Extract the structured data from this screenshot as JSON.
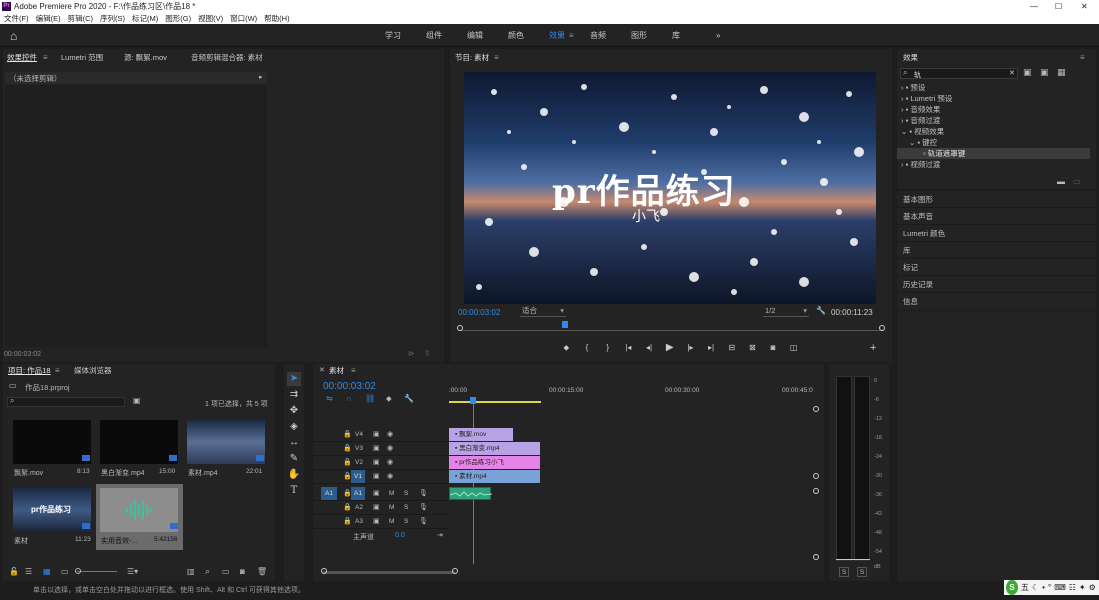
{
  "title": "Adobe Premiere Pro 2020 - F:\\作品练习区\\作品18 *",
  "menu": [
    "文件(F)",
    "编辑(E)",
    "剪辑(C)",
    "序列(S)",
    "标记(M)",
    "图形(G)",
    "视图(V)",
    "窗口(W)",
    "帮助(H)"
  ],
  "workspaces": [
    "学习",
    "组件",
    "编辑",
    "颜色",
    "效果",
    "音频",
    "图形",
    "库"
  ],
  "active_workspace": "效果",
  "more_icon": "»",
  "source_panel": {
    "tabs": [
      "效果控件",
      "Lumetri 范围",
      "源: 飘絮.mov",
      "音频剪辑混合器: 素材"
    ],
    "no_clip": "（未选择剪辑）",
    "timecode": "00:00:03:02"
  },
  "program": {
    "title": "节目: 素材",
    "overlay_text": "pr作品练习",
    "overlay_sub": "小飞",
    "timecode": "00:00:03:02",
    "fit": "适合",
    "quality": "1/2",
    "duration": "00:00:11:23"
  },
  "project": {
    "tabs": [
      "项目: 作品18",
      "媒体浏览器"
    ],
    "file": "作品18.prproj",
    "selection": "1 项已选择，共 5 项",
    "items": [
      {
        "name": "飘絮.mov",
        "dur": "8:13"
      },
      {
        "name": "黑白渐变.mp4",
        "dur": "15:00"
      },
      {
        "name": "素材.mp4",
        "dur": "22:01"
      },
      {
        "name": "素材",
        "dur": "11:23",
        "thumb_text": "pr作品练习"
      },
      {
        "name": "实用音效-...",
        "dur": "5:42156"
      }
    ]
  },
  "timeline": {
    "title": "素材",
    "timecode": "00:00:03:02",
    "ruler": [
      ":00:00",
      "00:00:15:00",
      "00:00:30:00",
      "00:00:45:0"
    ],
    "tracks": [
      {
        "name": "V4"
      },
      {
        "name": "V3"
      },
      {
        "name": "V2"
      },
      {
        "name": "V1"
      },
      {
        "name": "A1",
        "src": "A1"
      },
      {
        "name": "A2"
      },
      {
        "name": "A3"
      }
    ],
    "master": "主声道",
    "master_val": "0.0",
    "clips": [
      {
        "label": "飘絮.mov",
        "color": "#b7a2e6"
      },
      {
        "label": "黑白渐变.mp4",
        "color": "#b7a2e6"
      },
      {
        "label": "pr作品练习小飞",
        "color": "#e683e6"
      },
      {
        "label": "素材.mp4",
        "color": "#7aa2d6"
      }
    ]
  },
  "meter": {
    "ticks": [
      "0",
      "-6",
      "-12",
      "-18",
      "-24",
      "-30",
      "-36",
      "-42",
      "-48",
      "-54",
      "dB"
    ],
    "solo": [
      "S",
      "S"
    ]
  },
  "effects": {
    "title": "效果",
    "search": "轨",
    "tree": [
      {
        "label": "预设",
        "level": 0
      },
      {
        "label": "Lumetri 预设",
        "level": 0
      },
      {
        "label": "音频效果",
        "level": 0
      },
      {
        "label": "音频过渡",
        "level": 0
      },
      {
        "label": "视频效果",
        "level": 0,
        "open": true
      },
      {
        "label": "键控",
        "level": 1,
        "open": true
      },
      {
        "label": "轨道遮罩键",
        "level": 2,
        "selected": true
      },
      {
        "label": "视频过渡",
        "level": 0
      }
    ],
    "sections": [
      "基本图形",
      "基本声音",
      "Lumetri 颜色",
      "库",
      "标记",
      "历史记录",
      "信息"
    ]
  },
  "status": "单击以选择，或单击空白处并拖动以进行框选。使用 Shift、Alt 和 Ctrl 可获得其他选项。",
  "tray": [
    "S",
    "五",
    "☾",
    "•",
    "°",
    "⌨",
    "☷",
    "✦",
    "⚙"
  ],
  "colors": {
    "accent": "#2d8ceb",
    "track_blue": "#2b5d8a",
    "audio_clip": "#2fa27c",
    "playhead": "#2d8ceb"
  }
}
